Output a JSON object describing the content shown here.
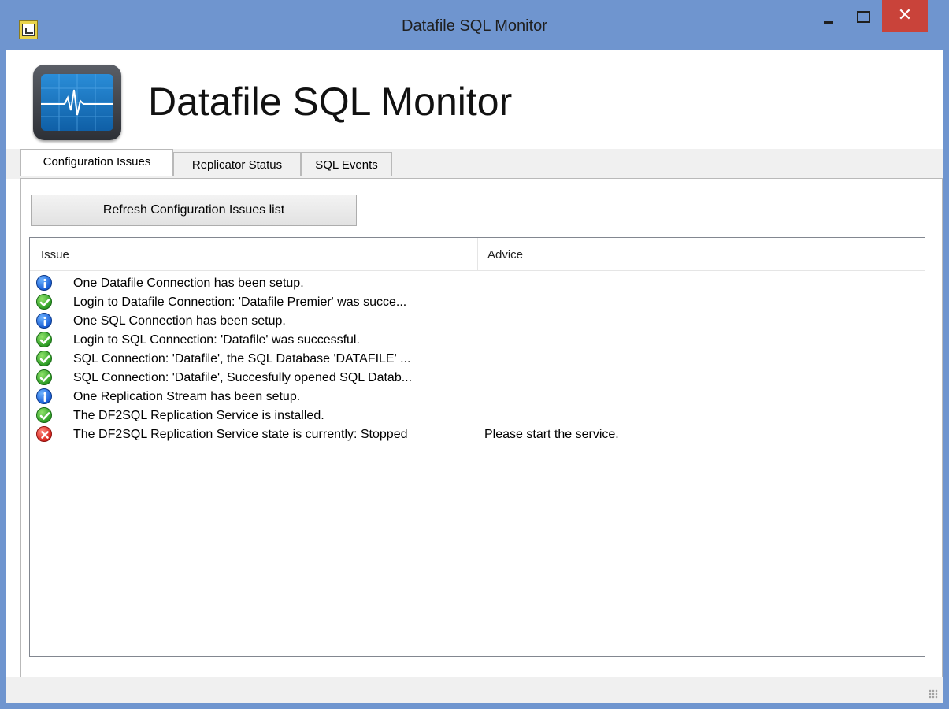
{
  "window": {
    "title": "Datafile SQL Monitor"
  },
  "header": {
    "title": "Datafile SQL Monitor"
  },
  "tabs": [
    {
      "label": "Configuration Issues",
      "active": true
    },
    {
      "label": "Replicator Status",
      "active": false
    },
    {
      "label": "SQL Events",
      "active": false
    }
  ],
  "toolbar": {
    "refresh_label": "Refresh Configuration Issues list"
  },
  "list": {
    "columns": {
      "issue": "Issue",
      "advice": "Advice"
    },
    "rows": [
      {
        "icon": "info-icon",
        "issue": "One Datafile Connection has been setup.",
        "advice": ""
      },
      {
        "icon": "check-icon",
        "issue": "Login to Datafile Connection: 'Datafile Premier' was succe...",
        "advice": ""
      },
      {
        "icon": "info-icon",
        "issue": "One SQL Connection has been setup.",
        "advice": ""
      },
      {
        "icon": "check-icon",
        "issue": "Login to SQL Connection: 'Datafile' was successful.",
        "advice": ""
      },
      {
        "icon": "check-icon",
        "issue": "SQL Connection: 'Datafile', the SQL Database 'DATAFILE' ...",
        "advice": ""
      },
      {
        "icon": "check-icon",
        "issue": "SQL Connection: 'Datafile', Succesfully opened SQL Datab...",
        "advice": ""
      },
      {
        "icon": "info-icon",
        "issue": "One Replication Stream has been setup.",
        "advice": ""
      },
      {
        "icon": "check-icon",
        "issue": "The DF2SQL Replication Service is installed.",
        "advice": ""
      },
      {
        "icon": "error-icon",
        "issue": "The DF2SQL Replication Service state is currently: Stopped",
        "advice": "Please start the service."
      }
    ]
  },
  "colors": {
    "titlebar": "#6f95cf",
    "close_button": "#c9433a",
    "info": "#1b5fd6",
    "ok": "#2e9d26",
    "error": "#d7261e"
  }
}
